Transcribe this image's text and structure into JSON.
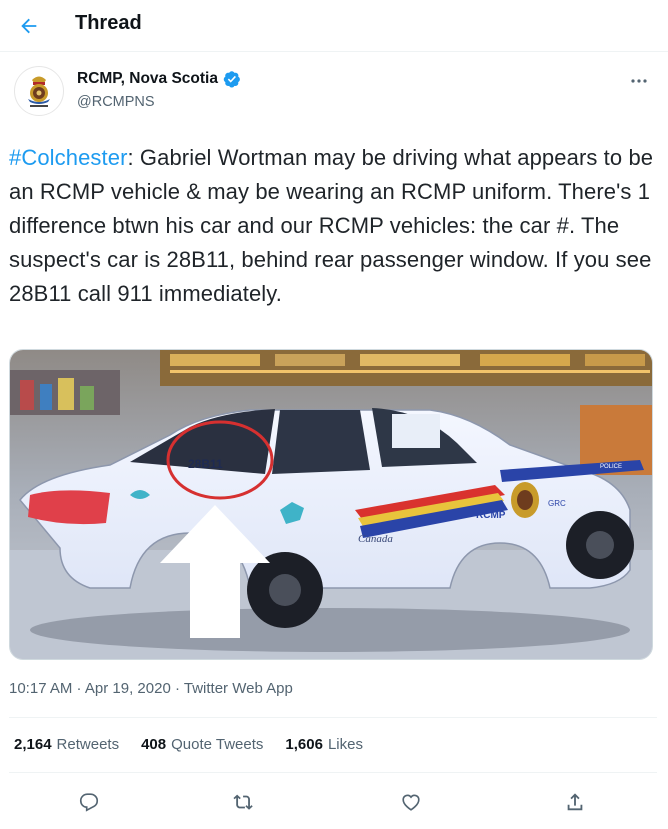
{
  "header": {
    "title": "Thread",
    "back_icon": "arrow-left-icon"
  },
  "author": {
    "name": "RCMP, Nova Scotia",
    "handle": "@RCMPNS",
    "verified": true,
    "avatar_icon": "rcmp-crest-icon"
  },
  "tweet": {
    "hashtag": "#Colchester",
    "text": ": Gabriel Wortman may be driving what appears to be an RCMP vehicle & may be wearing an RCMP uniform. There's 1 difference btwn his car and our RCMP vehicles: the car #. The suspect's car is 28B11, behind rear passenger window. If you see 28B11 call 911 immediately."
  },
  "media": {
    "car_number": "28B11",
    "door_text": "RCMP",
    "door_text_fr": "GRC",
    "canada_text": "Canada",
    "police_text": "POLICE"
  },
  "meta": {
    "time": "10:17 AM",
    "separator": " · ",
    "date": "Apr 19, 2020",
    "source": "Twitter Web App"
  },
  "stats": {
    "retweets": {
      "count": "2,164",
      "label": "Retweets"
    },
    "quotes": {
      "count": "408",
      "label": "Quote Tweets"
    },
    "likes": {
      "count": "1,606",
      "label": "Likes"
    }
  },
  "actions": [
    "reply-icon",
    "retweet-icon",
    "like-icon",
    "share-icon"
  ],
  "colors": {
    "accent": "#1d9bf0",
    "text": "#0f1419",
    "secondary": "#536471"
  }
}
